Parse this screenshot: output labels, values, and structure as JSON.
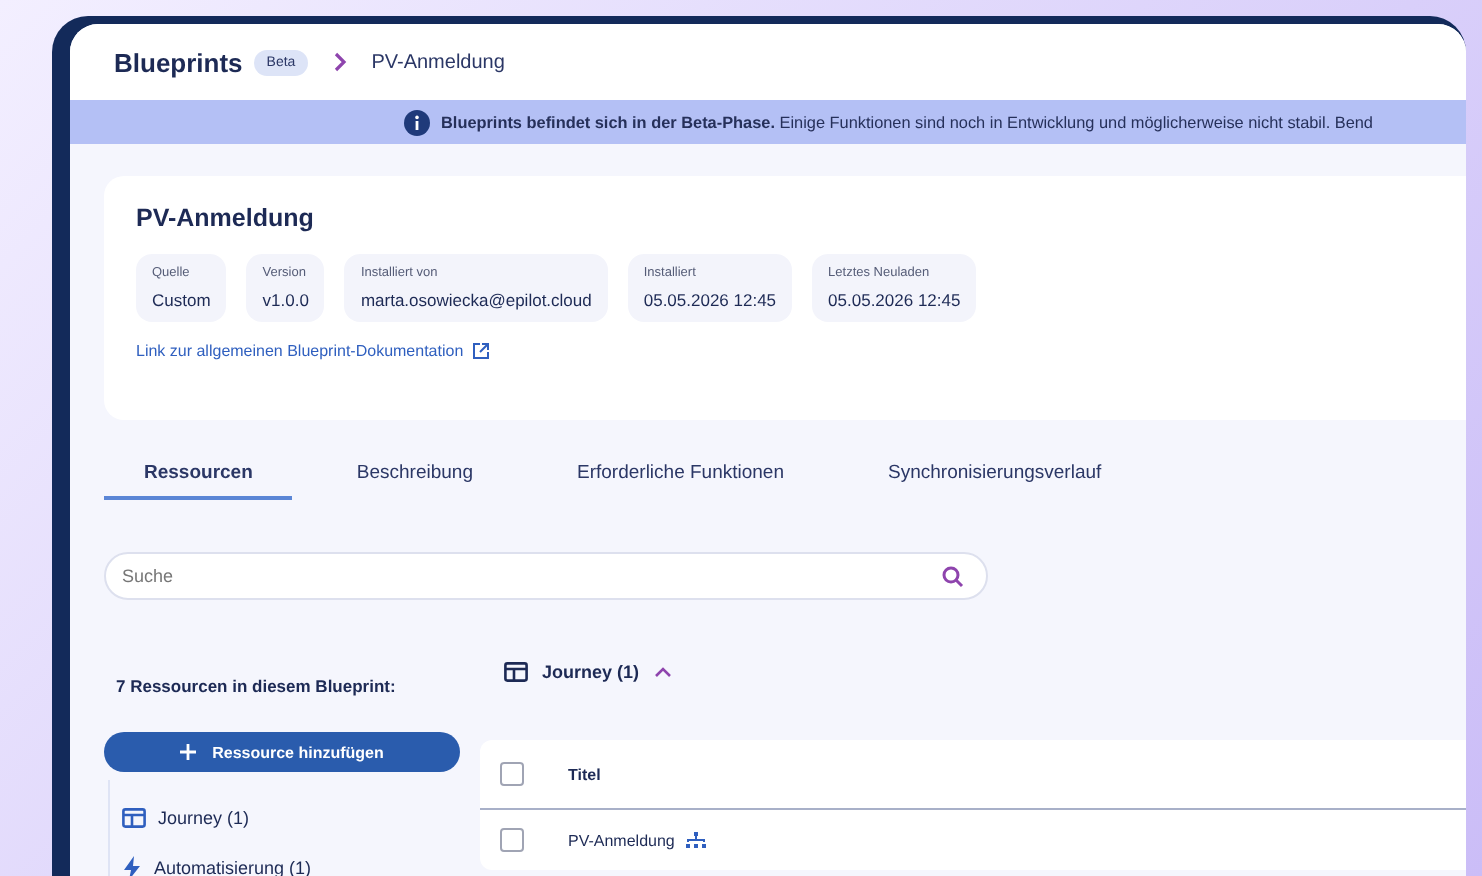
{
  "header": {
    "title": "Blueprints",
    "badge": "Beta",
    "breadcrumb": "PV-Anmeldung"
  },
  "banner": {
    "bold": "Blueprints befindet sich in der Beta-Phase.",
    "text": "Einige Funktionen sind noch in Entwicklung und möglicherweise nicht stabil. Bend"
  },
  "card": {
    "title": "PV-Anmeldung",
    "fields": [
      {
        "label": "Quelle",
        "value": "Custom"
      },
      {
        "label": "Version",
        "value": "v1.0.0"
      },
      {
        "label": "Installiert von",
        "value": "marta.osowiecka@epilot.cloud"
      },
      {
        "label": "Installiert",
        "value": "05.05.2026 12:45"
      },
      {
        "label": "Letztes Neuladen",
        "value": "05.05.2026 12:45"
      }
    ],
    "link": "Link zur allgemeinen Blueprint-Dokumentation"
  },
  "tabs": [
    {
      "label": "Ressourcen",
      "selected": true
    },
    {
      "label": "Beschreibung",
      "selected": false
    },
    {
      "label": "Erforderliche Funktionen",
      "selected": false
    },
    {
      "label": "Synchronisierungsverlauf",
      "selected": false
    }
  ],
  "search": {
    "placeholder": "Suche"
  },
  "sidebar": {
    "heading": "7 Ressourcen in diesem Blueprint:",
    "add_button": "Ressource hinzufügen",
    "items": [
      {
        "kind": "journey",
        "label": "Journey (1)"
      },
      {
        "kind": "automation",
        "label": "Automatisierung (1)"
      }
    ]
  },
  "group": {
    "kind": "journey",
    "title": "Journey (1)",
    "expanded": true
  },
  "table": {
    "columns": [
      "Titel"
    ],
    "rows": [
      {
        "title": "PV-Anmeldung",
        "checked": false
      }
    ],
    "all_checked": false
  }
}
